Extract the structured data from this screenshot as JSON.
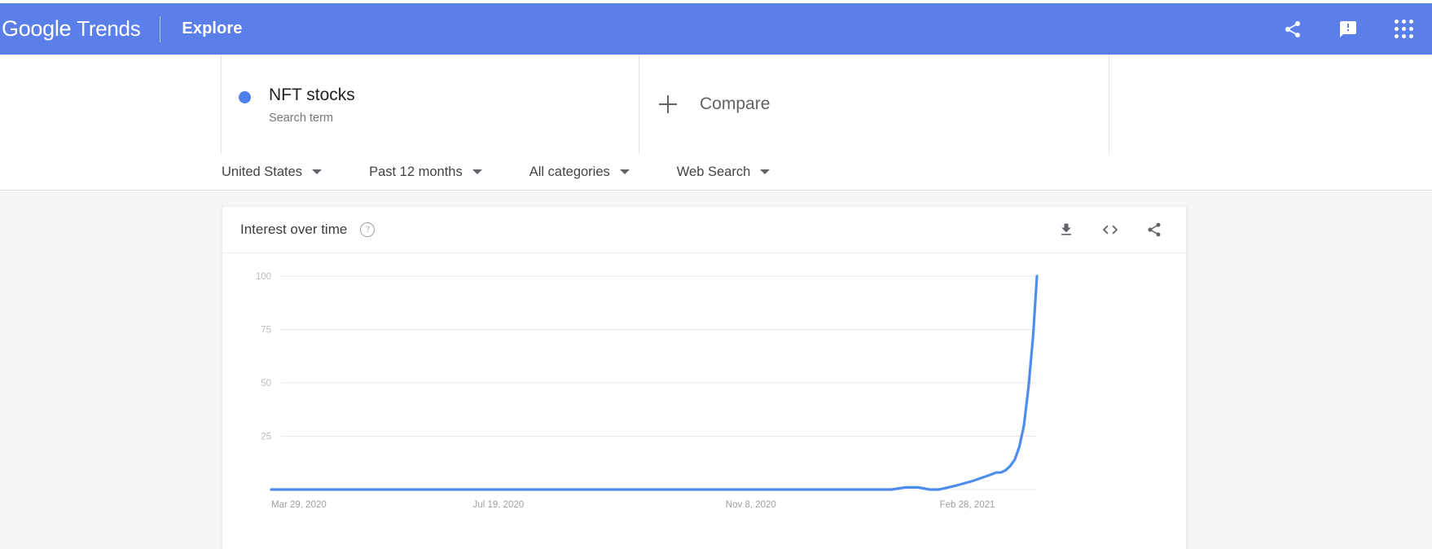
{
  "appbar": {
    "logo_text": "Google",
    "product_text": "Trends",
    "section": "Explore",
    "icons": [
      {
        "name": "share-icon",
        "label": "Share"
      },
      {
        "name": "feedback-icon",
        "label": "Send feedback"
      },
      {
        "name": "google-apps-icon",
        "label": "Google apps"
      }
    ]
  },
  "query": {
    "term": "NFT stocks",
    "term_type": "Search term",
    "term_color": "#4e7fea",
    "compare_label": "Compare"
  },
  "filters": [
    {
      "name": "location",
      "value": "United States"
    },
    {
      "name": "time-range",
      "value": "Past 12 months"
    },
    {
      "name": "category",
      "value": "All categories"
    },
    {
      "name": "search-type",
      "value": "Web Search"
    }
  ],
  "chart_card": {
    "title": "Interest over time",
    "help_glyph": "?",
    "actions": [
      {
        "name": "download-csv-icon",
        "label": "Download"
      },
      {
        "name": "embed-code-icon",
        "label": "Embed"
      },
      {
        "name": "share-chart-icon",
        "label": "Share"
      }
    ]
  },
  "chart_data": {
    "type": "line",
    "title": "Interest over time",
    "xlabel": "",
    "ylabel": "",
    "ylim": [
      0,
      100
    ],
    "yticks": [
      100,
      75,
      50,
      25
    ],
    "grid": true,
    "legend": [
      "NFT stocks"
    ],
    "line_color": "#4e8cf0",
    "xtick_labels": [
      "Mar 29, 2020",
      "Jul 19, 2020",
      "Nov 8, 2020",
      "Feb 28, 2021"
    ],
    "xtick_positions": [
      0,
      0.2967,
      0.6264,
      0.9451
    ],
    "series": [
      {
        "name": "NFT stocks",
        "x": [
          0.0,
          0.03,
          0.06,
          0.09,
          0.12,
          0.15,
          0.18,
          0.21,
          0.24,
          0.27,
          0.3,
          0.33,
          0.36,
          0.39,
          0.42,
          0.45,
          0.48,
          0.51,
          0.54,
          0.57,
          0.6,
          0.63,
          0.66,
          0.69,
          0.715,
          0.74,
          0.765,
          0.79,
          0.81,
          0.828,
          0.845,
          0.86,
          0.872,
          0.884,
          0.896,
          0.906,
          0.916,
          0.924,
          0.932,
          0.94,
          0.947,
          0.953,
          0.959,
          0.965,
          0.971,
          0.977,
          0.983,
          0.989,
          0.995,
          1.0
        ],
        "values": [
          0,
          0,
          0,
          0,
          0,
          0,
          0,
          0,
          0,
          0,
          0,
          0,
          0,
          0,
          0,
          0,
          0,
          0,
          0,
          0,
          0,
          0,
          0,
          0,
          0,
          0,
          0,
          0,
          0,
          1,
          1,
          0,
          0,
          1,
          2,
          3,
          4,
          5,
          6,
          7,
          8,
          8,
          9,
          11,
          14,
          20,
          30,
          48,
          72,
          100
        ]
      }
    ]
  }
}
